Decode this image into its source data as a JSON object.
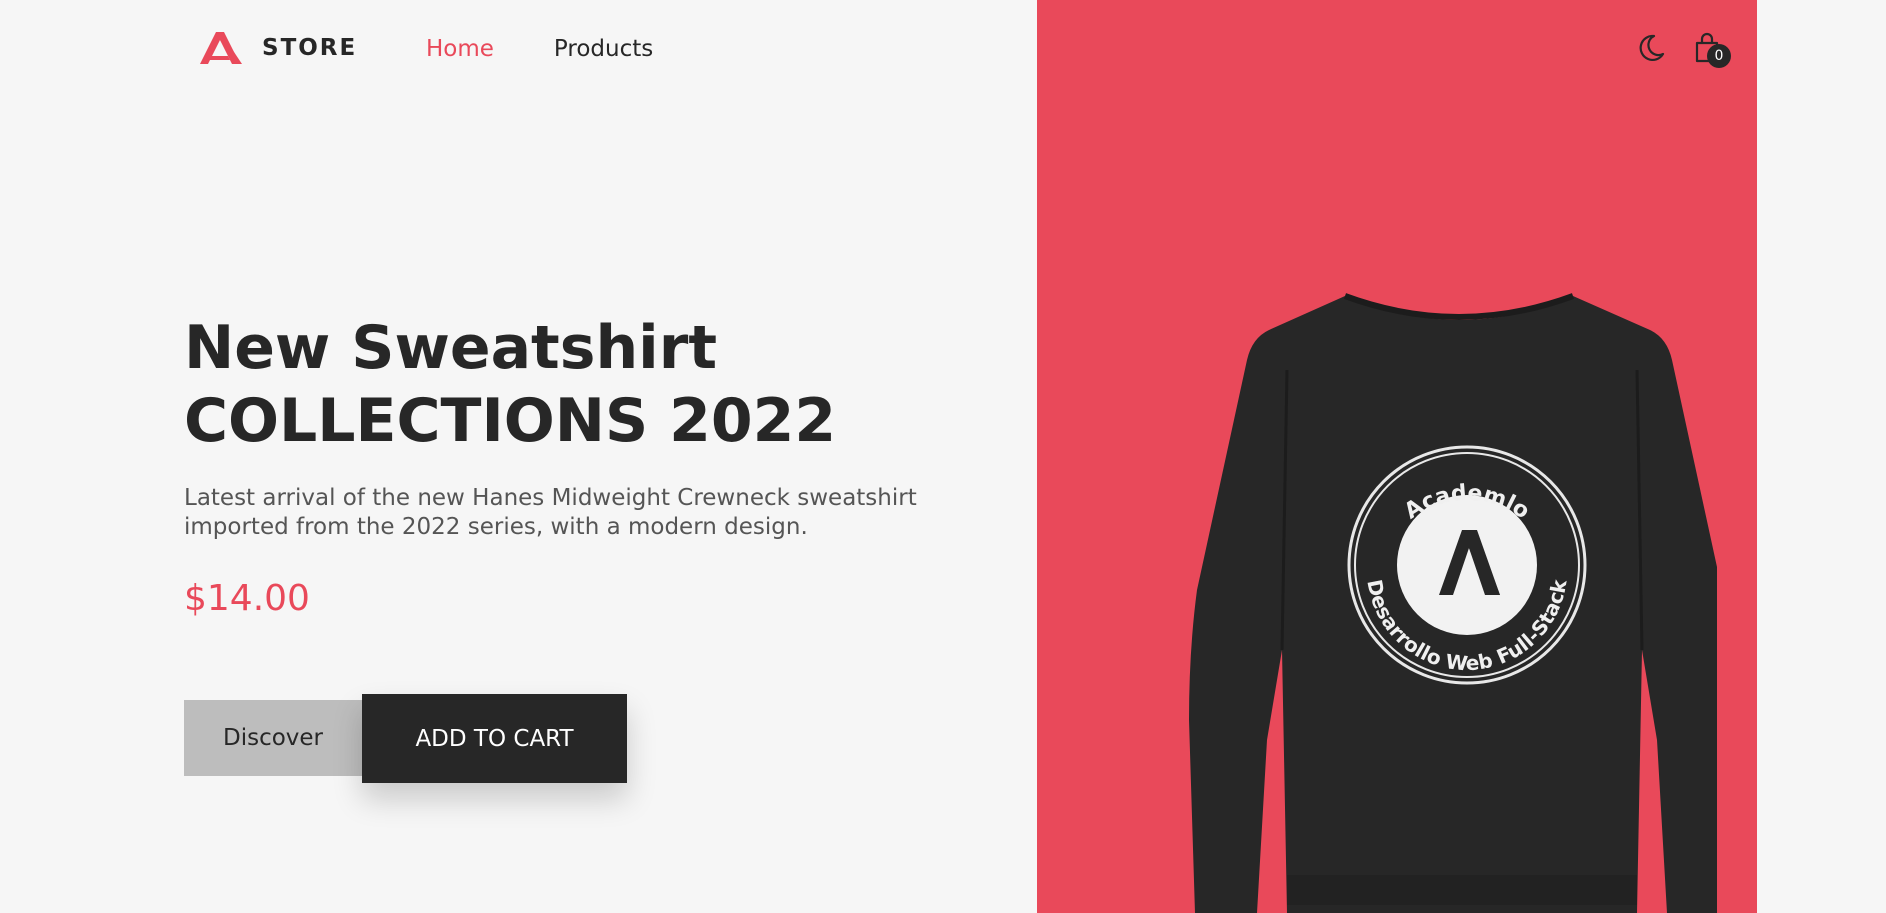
{
  "header": {
    "logo_text": "STORE",
    "nav": [
      {
        "label": "Home",
        "active": true
      },
      {
        "label": "Products",
        "active": false
      }
    ],
    "icons": [
      "moon-icon",
      "shopping-bag-icon"
    ],
    "cart_count": "0"
  },
  "hero": {
    "title_line1": "New Sweatshirt",
    "title_line2": "COLLECTIONS 2022",
    "description": "Latest arrival of the new Hanes Midweight Crewneck sweatshirt imported from the 2022 series, with a modern design.",
    "price": "$14.00",
    "discover_label": "Discover",
    "add_to_cart_label": "ADD TO CART"
  },
  "product_image": {
    "badge_top_text": "Academlo",
    "badge_bottom_text": "Desarrollo Web Full-Stack"
  },
  "colors": {
    "accent": "#e9495a",
    "dark": "#272727",
    "background": "#f6f6f6",
    "secondary_button": "#bdbdbd"
  }
}
